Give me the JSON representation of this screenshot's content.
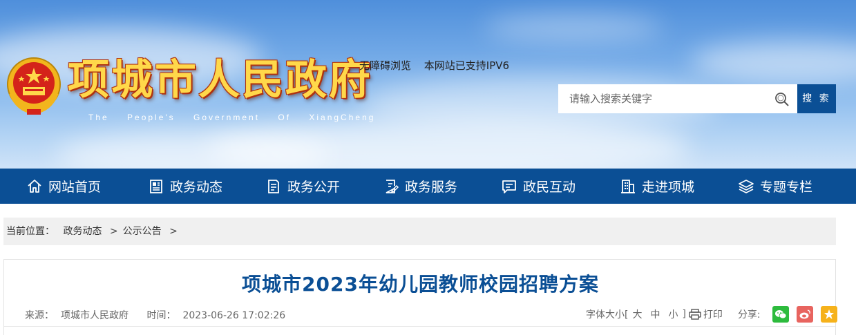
{
  "header": {
    "site_title": "项城市人民政府",
    "site_subtitle": "The People's Government Of XiangCheng",
    "top_links": [
      "无障碍浏览",
      "本网站已支持IPV6"
    ],
    "search": {
      "placeholder": "请输入搜索关键字",
      "button_label": "搜 索"
    }
  },
  "nav": {
    "items": [
      {
        "label": "网站首页",
        "icon": "home-icon"
      },
      {
        "label": "政务动态",
        "icon": "news-icon"
      },
      {
        "label": "政务公开",
        "icon": "document-icon"
      },
      {
        "label": "政务服务",
        "icon": "service-icon"
      },
      {
        "label": "政民互动",
        "icon": "chat-icon"
      },
      {
        "label": "走进项城",
        "icon": "building-icon"
      },
      {
        "label": "专题专栏",
        "icon": "layers-icon"
      }
    ]
  },
  "breadcrumb": {
    "prefix": "当前位置：",
    "items": [
      "政务动态",
      "公示公告"
    ],
    "separator": ">"
  },
  "article": {
    "title": "项城市2023年幼儿园教师校园招聘方案",
    "source_label": "来源：",
    "source": "项城市人民政府",
    "time_label": "时间：",
    "time": "2023-06-26 17:02:26",
    "font_size_label": "字体大小[",
    "font_large": "大",
    "font_medium": "中",
    "font_small": "小",
    "font_close": "]",
    "print_label": "打印",
    "share_label": "分享:"
  },
  "colors": {
    "nav_bg": "#0b4f95",
    "title_color": "#0b4f95",
    "wechat": "#2dbb3d",
    "weibo": "#e8645f",
    "qzone": "#f6b21b"
  }
}
